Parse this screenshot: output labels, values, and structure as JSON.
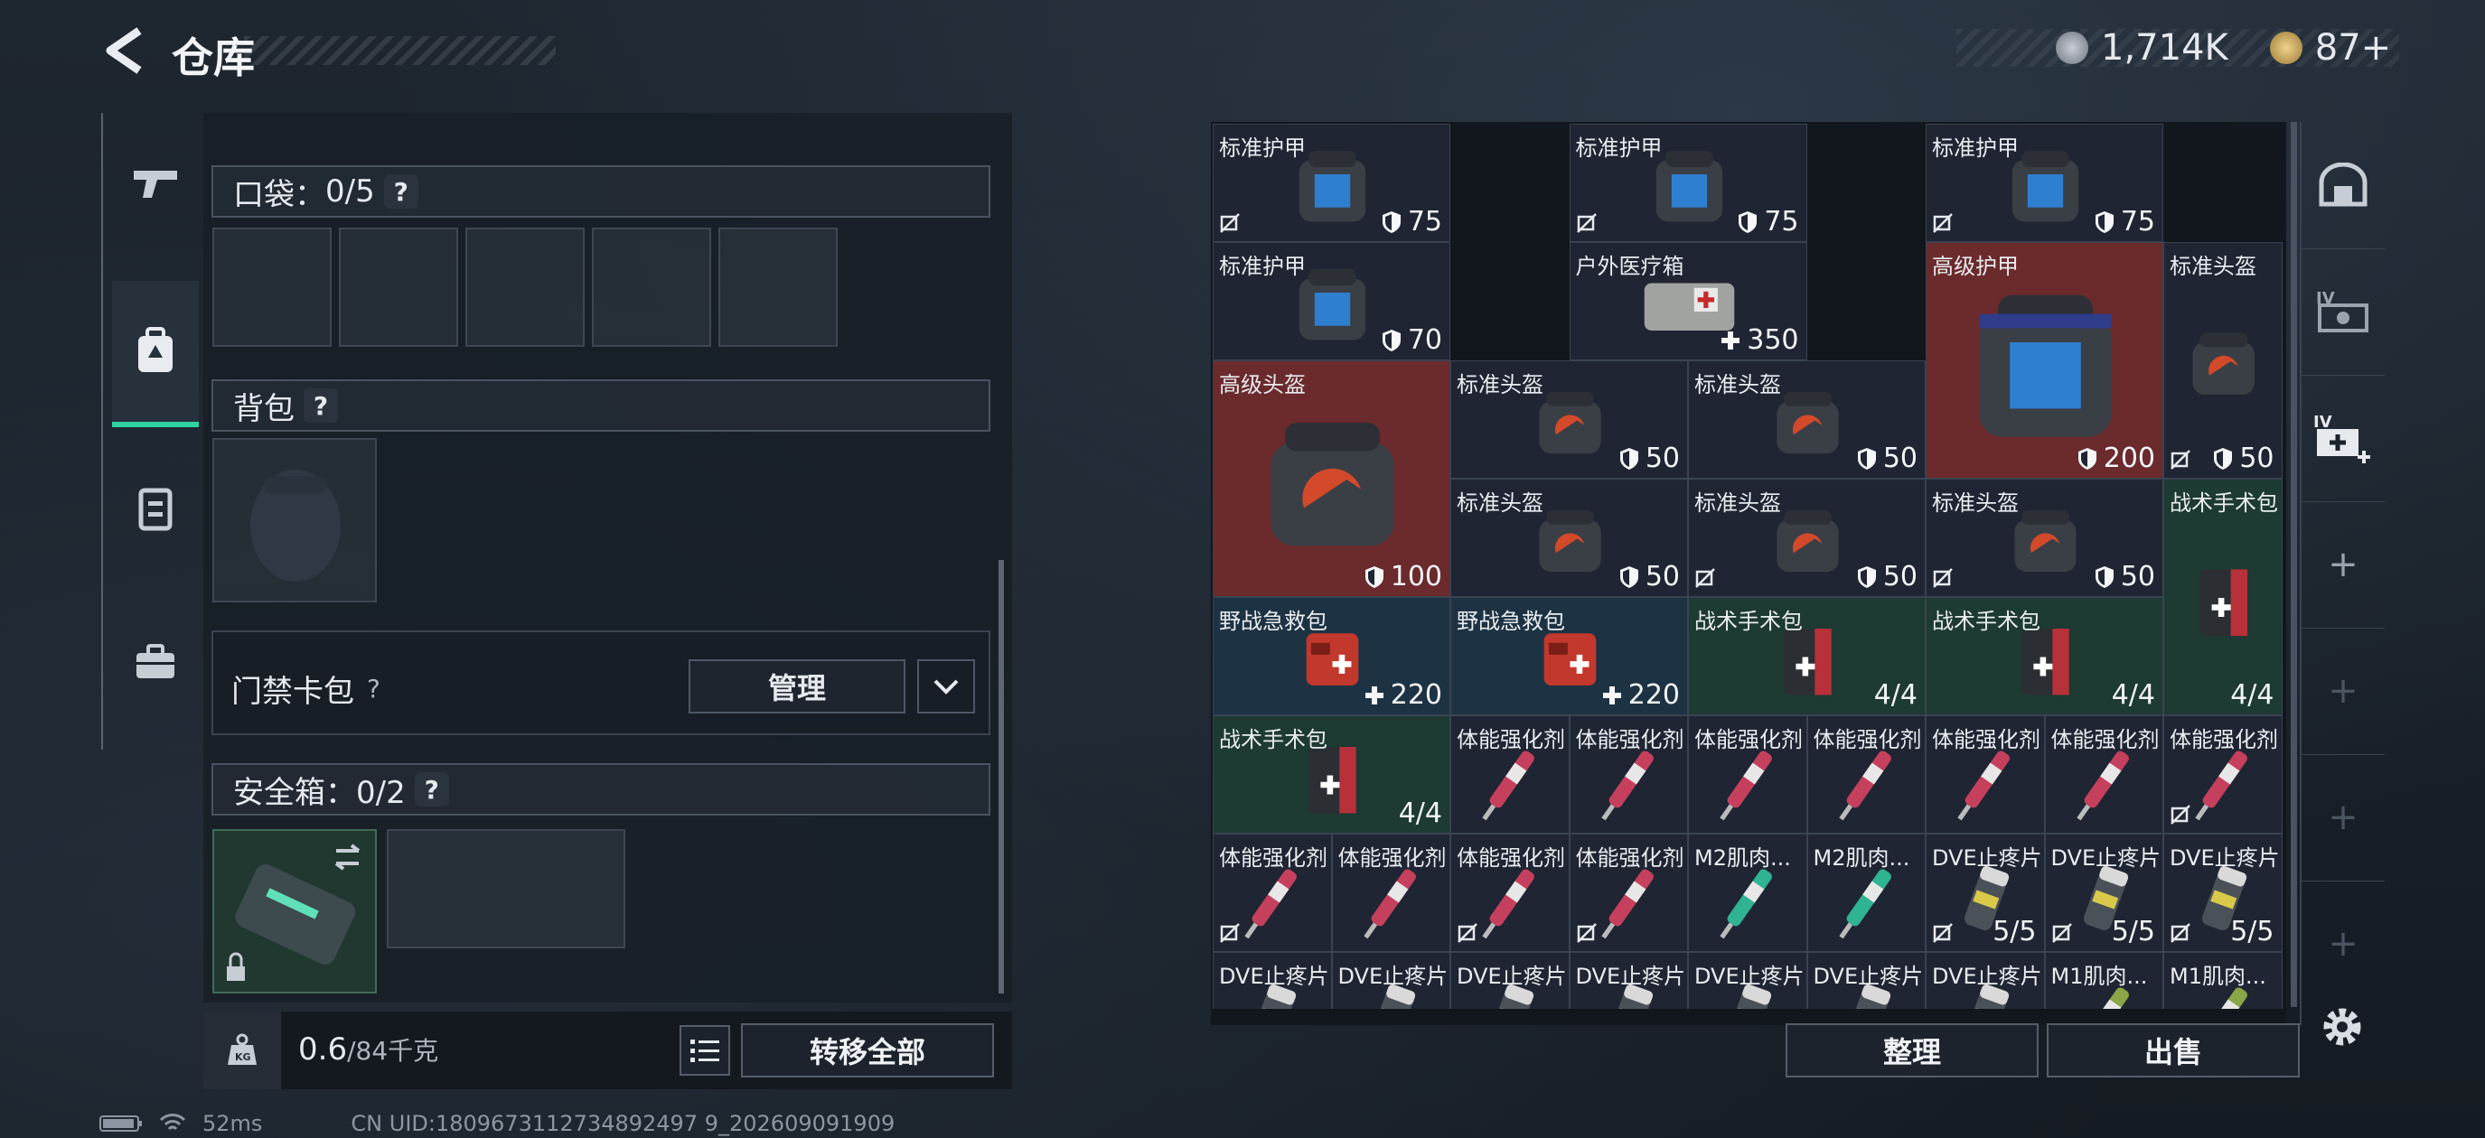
{
  "header": {
    "title": "仓库"
  },
  "currency": {
    "silver": "1,714K",
    "gold": "87+"
  },
  "left": {
    "pocket": {
      "label": "口袋：",
      "count": "0/5"
    },
    "backpack": {
      "label": "背包"
    },
    "card": {
      "label": "门禁卡包",
      "manage": "管理"
    },
    "safe": {
      "label": "安全箱：0/2"
    },
    "weight": {
      "current": "0.6",
      "capacity": "/84千克"
    },
    "transfer": "转移全部"
  },
  "grid": {
    "items": [
      {
        "name": "标准护甲",
        "val": "75",
        "type": "armor",
        "col": 0,
        "row": 0,
        "w": 2,
        "h": 1,
        "nob": true
      },
      {
        "name": "标准护甲",
        "val": "75",
        "type": "armor",
        "col": 3,
        "row": 0,
        "w": 2,
        "h": 1,
        "nob": true
      },
      {
        "name": "标准护甲",
        "val": "75",
        "type": "armor",
        "col": 6,
        "row": 0,
        "w": 2,
        "h": 1,
        "nob": true
      },
      {
        "name": "标准护甲",
        "val": "70",
        "type": "armor",
        "col": 0,
        "row": 1,
        "w": 2,
        "h": 1,
        "nob": false
      },
      {
        "name": "户外医疗箱",
        "val": "350",
        "type": "medkit",
        "col": 3,
        "row": 1,
        "w": 2,
        "h": 1,
        "nob": false
      },
      {
        "name": "高级护甲",
        "val": "200",
        "type": "armor-adv",
        "col": 6,
        "row": 1,
        "w": 2,
        "h": 2,
        "nob": false
      },
      {
        "name": "标准头盔",
        "val": "50",
        "type": "helmet",
        "col": 8,
        "row": 1,
        "w": 1,
        "h": 2,
        "nob": true
      },
      {
        "name": "高级头盔",
        "val": "100",
        "type": "helmet-adv",
        "col": 0,
        "row": 2,
        "w": 2,
        "h": 2,
        "nob": false
      },
      {
        "name": "标准头盔",
        "val": "50",
        "type": "helmet",
        "col": 2,
        "row": 2,
        "w": 2,
        "h": 1,
        "nob": false
      },
      {
        "name": "标准头盔",
        "val": "50",
        "type": "helmet",
        "col": 4,
        "row": 2,
        "w": 2,
        "h": 1,
        "nob": false
      },
      {
        "name": "标准头盔",
        "val": "50",
        "type": "helmet",
        "col": 2,
        "row": 3,
        "w": 2,
        "h": 1,
        "nob": false
      },
      {
        "name": "标准头盔",
        "val": "50",
        "type": "helmet",
        "col": 4,
        "row": 3,
        "w": 2,
        "h": 1,
        "nob": true
      },
      {
        "name": "标准头盔",
        "val": "50",
        "type": "helmet",
        "col": 6,
        "row": 3,
        "w": 2,
        "h": 1,
        "nob": true
      },
      {
        "name": "战术手术包",
        "val": "4/4",
        "type": "surg",
        "col": 8,
        "row": 3,
        "w": 1,
        "h": 2,
        "nob": false
      },
      {
        "name": "野战急救包",
        "val": "220",
        "type": "firstaid",
        "col": 0,
        "row": 4,
        "w": 2,
        "h": 1,
        "nob": false
      },
      {
        "name": "野战急救包",
        "val": "220",
        "type": "firstaid",
        "col": 2,
        "row": 4,
        "w": 2,
        "h": 1,
        "nob": false
      },
      {
        "name": "战术手术包",
        "val": "4/4",
        "type": "surg",
        "col": 4,
        "row": 4,
        "w": 2,
        "h": 1,
        "nob": false
      },
      {
        "name": "战术手术包",
        "val": "4/4",
        "type": "surg",
        "col": 6,
        "row": 4,
        "w": 2,
        "h": 1,
        "nob": false
      },
      {
        "name": "战术手术包",
        "val": "4/4",
        "type": "surg",
        "col": 0,
        "row": 5,
        "w": 2,
        "h": 1,
        "nob": false
      },
      {
        "name": "体能强化剂",
        "val": "",
        "type": "syr-red",
        "col": 2,
        "row": 5,
        "w": 1,
        "h": 1,
        "nob": false
      },
      {
        "name": "体能强化剂",
        "val": "",
        "type": "syr-red",
        "col": 3,
        "row": 5,
        "w": 1,
        "h": 1,
        "nob": false
      },
      {
        "name": "体能强化剂",
        "val": "",
        "type": "syr-red",
        "col": 4,
        "row": 5,
        "w": 1,
        "h": 1,
        "nob": false
      },
      {
        "name": "体能强化剂",
        "val": "",
        "type": "syr-red",
        "col": 5,
        "row": 5,
        "w": 1,
        "h": 1,
        "nob": false
      },
      {
        "name": "体能强化剂",
        "val": "",
        "type": "syr-red",
        "col": 6,
        "row": 5,
        "w": 1,
        "h": 1,
        "nob": false
      },
      {
        "name": "体能强化剂",
        "val": "",
        "type": "syr-red",
        "col": 7,
        "row": 5,
        "w": 1,
        "h": 1,
        "nob": false
      },
      {
        "name": "体能强化剂",
        "val": "",
        "type": "syr-red",
        "col": 8,
        "row": 5,
        "w": 1,
        "h": 1,
        "nob": true
      },
      {
        "name": "体能强化剂",
        "val": "",
        "type": "syr-red",
        "col": 0,
        "row": 6,
        "w": 1,
        "h": 1,
        "nob": true
      },
      {
        "name": "体能强化剂",
        "val": "",
        "type": "syr-red",
        "col": 1,
        "row": 6,
        "w": 1,
        "h": 1,
        "nob": false
      },
      {
        "name": "体能强化剂",
        "val": "",
        "type": "syr-red",
        "col": 2,
        "row": 6,
        "w": 1,
        "h": 1,
        "nob": true
      },
      {
        "name": "体能强化剂",
        "val": "",
        "type": "syr-red",
        "col": 3,
        "row": 6,
        "w": 1,
        "h": 1,
        "nob": true
      },
      {
        "name": "M2肌肉...",
        "val": "",
        "type": "syr-green",
        "col": 4,
        "row": 6,
        "w": 1,
        "h": 1,
        "nob": false
      },
      {
        "name": "M2肌肉...",
        "val": "",
        "type": "syr-green",
        "col": 5,
        "row": 6,
        "w": 1,
        "h": 1,
        "nob": false
      },
      {
        "name": "DVE止疼片",
        "val": "5/5",
        "type": "pill",
        "col": 6,
        "row": 6,
        "w": 1,
        "h": 1,
        "nob": true
      },
      {
        "name": "DVE止疼片",
        "val": "5/5",
        "type": "pill",
        "col": 7,
        "row": 6,
        "w": 1,
        "h": 1,
        "nob": true
      },
      {
        "name": "DVE止疼片",
        "val": "5/5",
        "type": "pill",
        "col": 8,
        "row": 6,
        "w": 1,
        "h": 1,
        "nob": true
      },
      {
        "name": "DVE止疼片",
        "val": "",
        "type": "pill",
        "col": 0,
        "row": 7,
        "w": 1,
        "h": 1,
        "nob": false
      },
      {
        "name": "DVE止疼片",
        "val": "",
        "type": "pill",
        "col": 1,
        "row": 7,
        "w": 1,
        "h": 1,
        "nob": false
      },
      {
        "name": "DVE止疼片",
        "val": "",
        "type": "pill",
        "col": 2,
        "row": 7,
        "w": 1,
        "h": 1,
        "nob": false
      },
      {
        "name": "DVE止疼片",
        "val": "",
        "type": "pill",
        "col": 3,
        "row": 7,
        "w": 1,
        "h": 1,
        "nob": false
      },
      {
        "name": "DVE止疼片",
        "val": "",
        "type": "pill",
        "col": 4,
        "row": 7,
        "w": 1,
        "h": 1,
        "nob": false
      },
      {
        "name": "DVE止疼片",
        "val": "",
        "type": "pill",
        "col": 5,
        "row": 7,
        "w": 1,
        "h": 1,
        "nob": false
      },
      {
        "name": "DVE止疼片",
        "val": "",
        "type": "pill",
        "col": 6,
        "row": 7,
        "w": 1,
        "h": 1,
        "nob": false
      },
      {
        "name": "M1肌肉...",
        "val": "",
        "type": "syr-olive",
        "col": 7,
        "row": 7,
        "w": 1,
        "h": 1,
        "nob": false
      },
      {
        "name": "M1肌肉...",
        "val": "",
        "type": "syr-olive",
        "col": 8,
        "row": 7,
        "w": 1,
        "h": 1,
        "nob": false
      }
    ],
    "buttons": {
      "sort": "整理",
      "sell": "出售"
    }
  },
  "status": {
    "ping": "52ms",
    "uid": "CN UID:1809673112734892497 9_202609091909"
  },
  "colors": {
    "accent": "#2fd3a2",
    "adv_red": "#6b2a2c",
    "green_bg": "#1d3a33",
    "blue_bg": "#1d3344",
    "default_bg": "#1f2533"
  }
}
